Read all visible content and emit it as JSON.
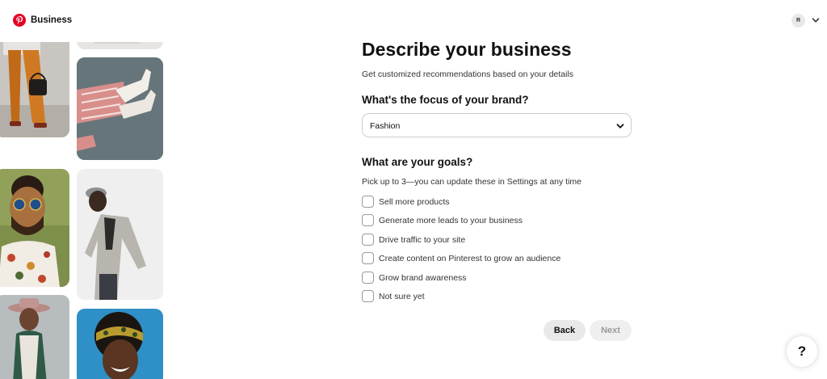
{
  "header": {
    "brand_label": "Business",
    "avatar_initial": "R",
    "logo_color": "#e60023"
  },
  "main": {
    "title": "Describe your business",
    "subtitle": "Get customized recommendations based on your details",
    "focus_heading": "What's the focus of your brand?",
    "focus_selected": "Fashion",
    "goals_heading": "What are your goals?",
    "goals_hint": "Pick up to 3—you can update these in Settings at any time",
    "goals": [
      {
        "label": "Sell more products",
        "checked": false
      },
      {
        "label": "Generate more leads to your business",
        "checked": false
      },
      {
        "label": "Drive traffic to your site",
        "checked": false
      },
      {
        "label": "Create content on Pinterest to grow an audience",
        "checked": false
      },
      {
        "label": "Grow brand awareness",
        "checked": false
      },
      {
        "label": "Not sure yet",
        "checked": false
      }
    ],
    "back_label": "Back",
    "next_label": "Next"
  },
  "help": {
    "label": "?"
  }
}
